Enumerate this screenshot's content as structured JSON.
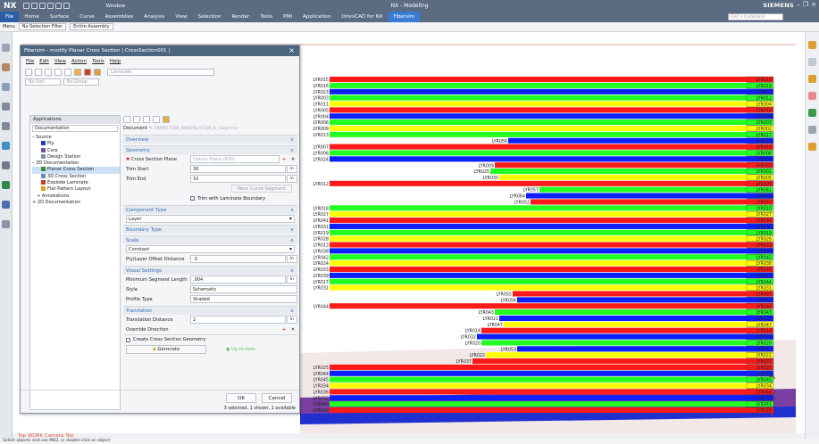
{
  "app": {
    "logo": "NX",
    "window_title": "NX - Modeling",
    "brand": "SIEMENS",
    "window_menu": "Window",
    "command_finder": "Find a Command"
  },
  "ribbon_tabs": [
    "File",
    "Home",
    "Surface",
    "Curve",
    "Assemblies",
    "Analysis",
    "View",
    "Selection",
    "Render",
    "Tools",
    "PMI",
    "Application",
    "OmniCAD for NX",
    "Fibersim"
  ],
  "toolbar": {
    "menu": "Menu",
    "selection_filter": "No Selection Filter",
    "scope": "Entire Assembly"
  },
  "dialog": {
    "title": "Fibersim - modify Planar Cross Section | CrossSection001 |",
    "menu": [
      "File",
      "Edit",
      "View",
      "Action",
      "Tools",
      "Help"
    ],
    "laminate_placeholder": "Laminate",
    "no_sort": "No Sort",
    "no_group": "No Group",
    "applications_header": "Applications",
    "applications_dropdown": "Documentation",
    "tree": [
      {
        "label": "Source",
        "indent": 0,
        "color": ""
      },
      {
        "label": "Ply",
        "indent": 2,
        "color": "#1e3fc4"
      },
      {
        "label": "Core",
        "indent": 2,
        "color": "#7a4fa0"
      },
      {
        "label": "Design Station",
        "indent": 2,
        "color": "#7a8ea3"
      },
      {
        "label": "3D Documentation",
        "indent": 0,
        "color": ""
      },
      {
        "label": "Planar Cross Section",
        "indent": 2,
        "color": "#3a8a3a",
        "selected": true
      },
      {
        "label": "3D Cross Section",
        "indent": 2,
        "color": "#6b8bb7"
      },
      {
        "label": "Explode Laminate",
        "indent": 2,
        "color": "#c04030"
      },
      {
        "label": "Flat Pattern Layout",
        "indent": 2,
        "color": "#e09a20"
      },
      {
        "label": "Annotations",
        "indent": 1,
        "color": ""
      },
      {
        "label": "2D Documentation",
        "indent": 0,
        "color": ""
      }
    ],
    "document_label": "Document",
    "document_value": "TRANSITION_MANIPULATION_0_Complete",
    "overview": "Overview",
    "geometry": "Geometry",
    "cross_section_plane_label": "Cross Section Plane",
    "cross_section_plane_value": "Datum Plane (830)",
    "trim_start_label": "Trim Start",
    "trim_start_value": "30",
    "unit": "in",
    "trim_end_label": "Trim End",
    "trim_end_value": "10",
    "next_curve_segment": "Next Curve Segment",
    "trim_with_boundary": "Trim with Laminate Boundary",
    "component_type": "Component Type",
    "component_value": "Layer",
    "boundary_type": "Boundary Type",
    "scale": "Scale",
    "scale_value": "Constant",
    "ply_offset_label": "Ply/Layer Offset Distance",
    "ply_offset_value": ".3",
    "visual_settings": "Visual Settings",
    "min_segment_label": "Minimum Segment Length",
    "min_segment_value": ".004",
    "style_label": "Style",
    "style_value": "Schematic",
    "profile_label": "Profile Type",
    "profile_value": "Shaded",
    "translation": "Translation",
    "translation_distance_label": "Translation Distance",
    "translation_distance_value": "2",
    "override_direction_label": "Override Direction",
    "create_geometry": "Create Cross Section Geometry",
    "generate": "Generate",
    "up_to_date": "Up-to-date",
    "ok": "OK",
    "cancel": "Cancel",
    "selection_info": "3 selected, 1 shown, 1 available"
  },
  "viewport": {
    "camera_label": "Top WORK Camera Top",
    "colors": {
      "red": "#ff1a1a",
      "blue": "#0b20ff",
      "green": "#22ff22",
      "yellow": "#ffff00",
      "teal": "#00c8c8"
    },
    "layers": [
      {
        "l": "LYR015",
        "r": "LYR018",
        "c": "red"
      },
      {
        "l": "LYR016",
        "r": "LYR019",
        "c": "green"
      },
      {
        "l": "LYR023",
        "r": "LYR032",
        "c": "blue"
      },
      {
        "l": "LYR003",
        "r": "LYR012",
        "c": "green"
      },
      {
        "l": "LYR011",
        "r": "LYR004",
        "c": "yellow"
      },
      {
        "l": "LYR005",
        "r": "LYR018",
        "c": "red"
      },
      {
        "l": "LYR004",
        "r": "LYR008",
        "c": "blue"
      },
      {
        "l": "LYR006",
        "r": "LYR003",
        "c": "green"
      },
      {
        "l": "LYR009",
        "r": "LYR002",
        "c": "yellow"
      },
      {
        "l": "LYR013",
        "r": "LYR017",
        "c": "green"
      },
      {
        "l": "LYR056",
        "r": "LYR055",
        "c": "blue",
        "inset": 200
      },
      {
        "l": "LYR007",
        "r": "LYR010",
        "c": "red"
      },
      {
        "l": "LYR006",
        "r": "LYR008",
        "c": "green"
      },
      {
        "l": "LYR024",
        "r": "LYR026",
        "c": "blue"
      },
      {
        "l": "LYR009",
        "r": "LYR050",
        "c": "red",
        "inset": 185
      },
      {
        "l": "LYR025",
        "r": "LYR002",
        "c": "green",
        "inset": 180
      },
      {
        "l": "LYR030",
        "r": "LYR005",
        "c": "yellow",
        "inset": 190
      },
      {
        "l": "LYR012",
        "r": "LYR009",
        "c": "red"
      },
      {
        "l": "LYR057",
        "r": "LYR061",
        "c": "green",
        "inset": 235
      },
      {
        "l": "LYR064",
        "r": "LYR062",
        "c": "blue",
        "inset": 220
      },
      {
        "l": "LYR052",
        "r": "LYR057",
        "c": "red",
        "inset": 225
      },
      {
        "l": "LYR018",
        "r": "LYR010",
        "c": "green"
      },
      {
        "l": "LYR027",
        "r": "LYR027",
        "c": "yellow"
      },
      {
        "l": "LYR041",
        "r": "LYR034",
        "c": "red"
      },
      {
        "l": "LYR031",
        "r": "LYR036",
        "c": "blue"
      },
      {
        "l": "LYR019",
        "r": "LYR019",
        "c": "green"
      },
      {
        "l": "LYR028",
        "r": "LYR026",
        "c": "yellow"
      },
      {
        "l": "LYR013",
        "r": "LYR033",
        "c": "red"
      },
      {
        "l": "LYR038",
        "r": "LYR039",
        "c": "blue"
      },
      {
        "l": "LYR042",
        "r": "LYR042",
        "c": "green"
      },
      {
        "l": "LYR024",
        "r": "LYR038",
        "c": "yellow"
      },
      {
        "l": "LYR033",
        "r": "LYR035",
        "c": "red"
      },
      {
        "l": "LYR039",
        "r": "LYR017",
        "c": "blue"
      },
      {
        "l": "LYR017",
        "r": "LYR044",
        "c": "green"
      },
      {
        "l": "LYR031",
        "r": "LYR031",
        "c": "yellow"
      },
      {
        "l": "LYR055",
        "r": "LYR055",
        "c": "red",
        "inset": 205
      },
      {
        "l": "LYR056",
        "r": "LYR060",
        "c": "blue",
        "inset": 210
      },
      {
        "l": "LYR044",
        "r": "LYR044",
        "c": "red"
      },
      {
        "l": "LYR043",
        "r": "LYR043",
        "c": "green",
        "inset": 185
      },
      {
        "l": "LYR021",
        "r": "LYR021",
        "c": "blue",
        "inset": 190
      },
      {
        "l": "LYR047",
        "r": "LYR047",
        "c": "yellow",
        "inset": 195
      },
      {
        "l": "LYR014",
        "r": "LYR014",
        "c": "red",
        "inset": 170
      },
      {
        "l": "LYR032",
        "r": "LYR032",
        "c": "blue",
        "inset": 165
      },
      {
        "l": "LYR020",
        "r": "LYR020",
        "c": "green",
        "inset": 170
      },
      {
        "l": "LYR053",
        "r": "LYR053",
        "c": "blue",
        "inset": 210
      },
      {
        "l": "LYR022",
        "r": "LYR022",
        "c": "yellow",
        "inset": 175
      },
      {
        "l": "LYR037",
        "r": "LYR037",
        "c": "red",
        "inset": 160
      },
      {
        "l": "LYR025",
        "r": "LYR026",
        "c": "red"
      },
      {
        "l": "LYR044",
        "r": "LYR046",
        "c": "blue"
      },
      {
        "l": "LYR045",
        "r": "LYR045",
        "c": "green"
      },
      {
        "l": "LYR034",
        "r": "LYR034",
        "c": "yellow"
      },
      {
        "l": "LYR036",
        "r": "LYR048",
        "c": "red"
      },
      {
        "l": "LYR032",
        "r": "LYR032",
        "c": "blue"
      },
      {
        "l": "LYR040",
        "r": "LYR041",
        "c": "green"
      },
      {
        "l": "LYR029",
        "r": "LYR029",
        "c": "red"
      }
    ]
  },
  "status": {
    "hint": "Select objects and use MB3, or double-click an object"
  }
}
